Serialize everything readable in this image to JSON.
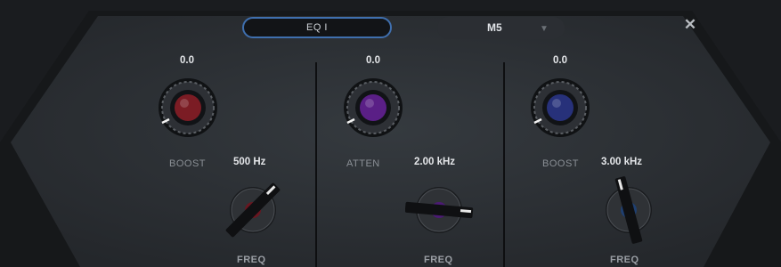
{
  "header": {
    "preset_field": "EQ I",
    "preset_select_value": "M5",
    "preset_select_chevron": "chevron-down-icon",
    "close_icon": "close-icon"
  },
  "bands": [
    {
      "gain_value": "0.0",
      "type_label": "BOOST",
      "freq_value": "500 Hz",
      "freq_label": "FREQ",
      "gain_knob_color": "#7b1c24",
      "freq_knob_color": "#6a1620"
    },
    {
      "gain_value": "0.0",
      "type_label": "ATTEN",
      "freq_value": "2.00 kHz",
      "freq_label": "FREQ",
      "gain_knob_color": "#5a1f86",
      "freq_knob_color": "#4b1a73"
    },
    {
      "gain_value": "0.0",
      "type_label": "BOOST",
      "freq_value": "3.00 kHz",
      "freq_label": "FREQ",
      "gain_knob_color": "#27317a",
      "freq_knob_color": "#1f3f70"
    }
  ],
  "colors": {
    "panel_bg": "#2a2d31",
    "field_border": "#3f6fae"
  }
}
